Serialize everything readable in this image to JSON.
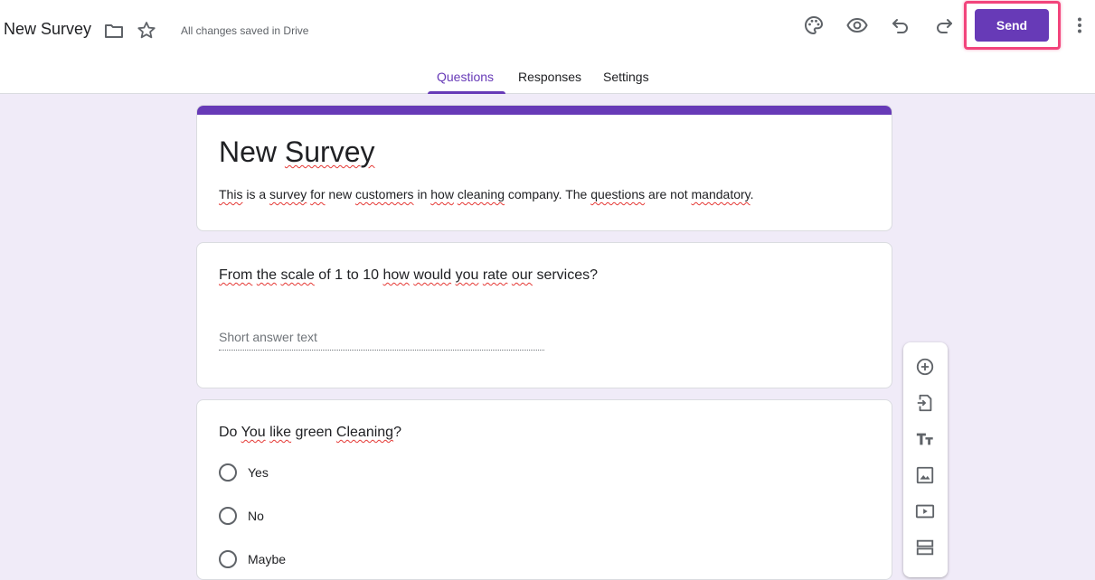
{
  "header": {
    "doc_title": "New Survey",
    "save_status": "All changes saved in Drive",
    "send_label": "Send",
    "icons": [
      "folder-icon",
      "star-icon",
      "palette-icon",
      "preview-eye-icon",
      "undo-icon",
      "redo-icon",
      "more-vert-icon"
    ]
  },
  "tabs": [
    {
      "label": "Questions",
      "active": true
    },
    {
      "label": "Responses",
      "active": false
    },
    {
      "label": "Settings",
      "active": false
    }
  ],
  "form": {
    "title": "New Survey",
    "description": "This is a survey for new customers in how cleaning company. The questions are not mandatory."
  },
  "questions": [
    {
      "text": "From the scale of 1 to 10 how would you rate our services?",
      "type": "short-answer",
      "placeholder": "Short answer text"
    },
    {
      "text": "Do You like green Cleaning?",
      "type": "multiple-choice",
      "options": [
        "Yes",
        "No",
        "Maybe"
      ]
    }
  ],
  "side_toolbar": {
    "icons": [
      "add-question-icon",
      "import-questions-icon",
      "add-title-icon",
      "add-image-icon",
      "add-video-icon",
      "add-section-icon"
    ]
  },
  "colors": {
    "accent": "#673ab7",
    "background": "#f0ebf8",
    "highlight": "#f2447c"
  }
}
